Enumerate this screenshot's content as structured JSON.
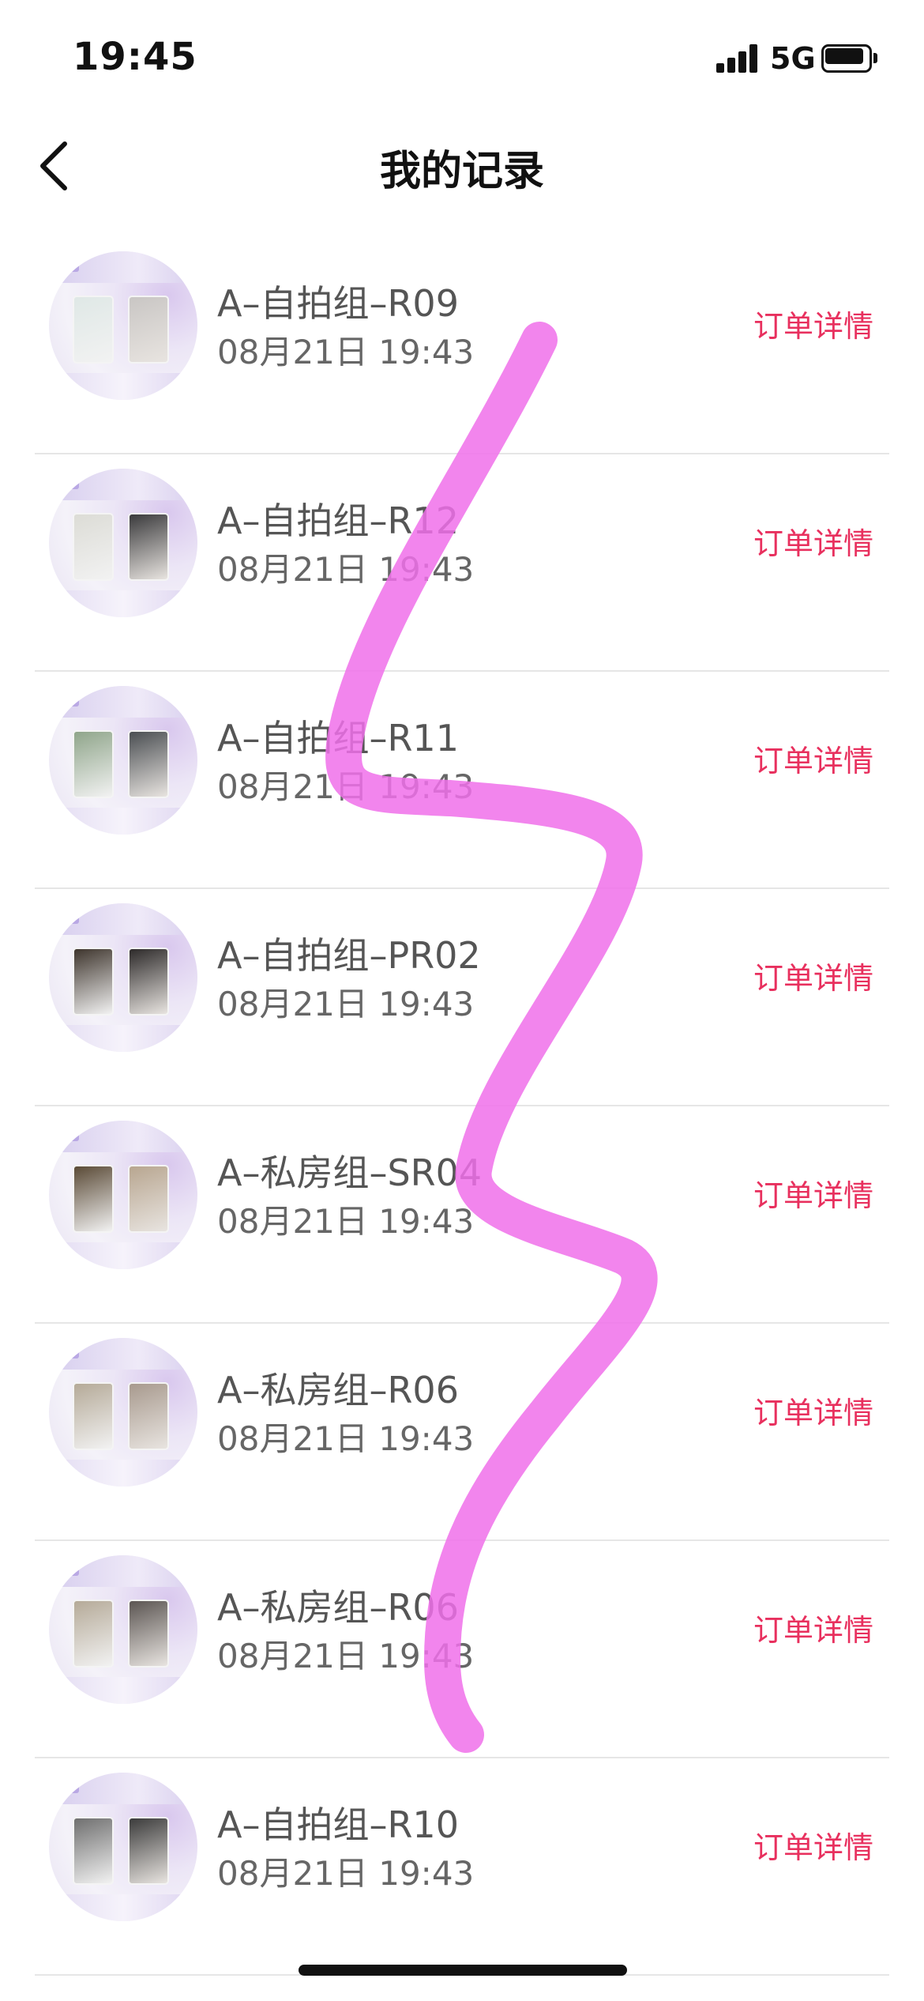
{
  "status_bar": {
    "time": "19:45",
    "network": "5G",
    "icons": [
      "signal-icon",
      "battery-icon"
    ]
  },
  "nav": {
    "title": "我的记录",
    "back_icon": "chevron-left-icon"
  },
  "records": [
    {
      "title": "A–自拍组–R09",
      "time": "08月21日 19:43",
      "action": "订单详情",
      "card_colors": [
        "#dfe8e6",
        "#c9c6c4"
      ]
    },
    {
      "title": "A–自拍组–R12",
      "time": "08月21日 19:43",
      "action": "订单详情",
      "card_colors": [
        "#dcdcd6",
        "#3a3a3c"
      ]
    },
    {
      "title": "A–自拍组–R11",
      "time": "08月21日 19:43",
      "action": "订单详情",
      "card_colors": [
        "#8fa58a",
        "#4a4e52"
      ]
    },
    {
      "title": "A–自拍组–PR02",
      "time": "08月21日 19:43",
      "action": "订单详情",
      "card_colors": [
        "#3e352d",
        "#2d2a2a"
      ]
    },
    {
      "title": "A–私房组–SR04",
      "time": "08月21日 19:43",
      "action": "订单详情",
      "card_colors": [
        "#5a4a36",
        "#b8a690"
      ]
    },
    {
      "title": "A–私房组–R06",
      "time": "08月21日 19:43",
      "action": "订单详情",
      "card_colors": [
        "#b5aa98",
        "#a89a8e"
      ]
    },
    {
      "title": "A–私房组–R06",
      "time": "08月21日 19:43",
      "action": "订单详情",
      "card_colors": [
        "#b5aa98",
        "#5b5552"
      ]
    },
    {
      "title": "A–自拍组–R10",
      "time": "08月21日 19:43",
      "action": "订单详情",
      "card_colors": [
        "#6f6f6f",
        "#3b3b3b"
      ]
    }
  ],
  "colors": {
    "accent": "#e8305e",
    "scribble": "#f070ea"
  }
}
